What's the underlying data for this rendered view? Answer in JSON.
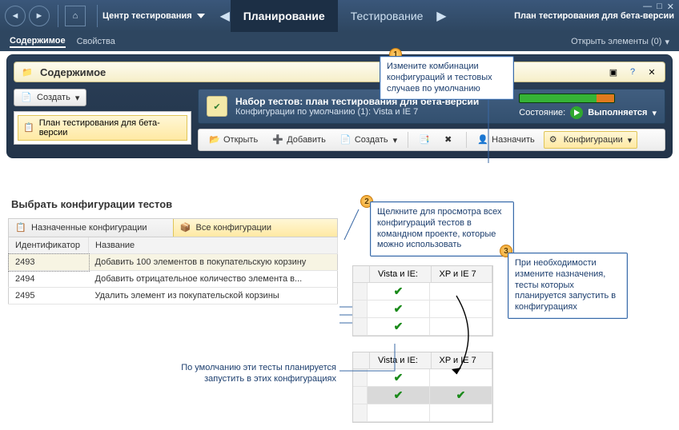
{
  "window": {
    "title": "Центр тестирования"
  },
  "nav": {
    "tabs": {
      "planning": "Планирование",
      "testing": "Тестирование"
    },
    "plan_info": "План тестирования для бета-версии"
  },
  "subnav": {
    "contents": "Содержимое",
    "properties": "Свойства",
    "open_items": "Открыть элементы (0)"
  },
  "panel": {
    "title": "Содержимое"
  },
  "sidebar": {
    "create_label": "Создать",
    "tree_item": "План тестирования для бета-версии"
  },
  "suite": {
    "title": "Набор тестов: план тестирования для бета-версии",
    "subtitle": "Конфигурации по умолчанию (1): Vista и IE 7",
    "state_label": "Состояние:",
    "state_value": "Выполняется"
  },
  "toolbar": {
    "open": "Открыть",
    "add": "Добавить",
    "create": "Создать",
    "assign": "Назначить",
    "configs": "Конфигурации"
  },
  "config_section": {
    "title": "Выбрать конфигурации тестов",
    "tab_assigned": "Назначенные конфигурации",
    "tab_all": "Все конфигурации",
    "columns": {
      "id": "Идентификатор",
      "name": "Название"
    },
    "rows": [
      {
        "id": "2493",
        "name": "Добавить 100 элементов в покупательскую корзину"
      },
      {
        "id": "2494",
        "name": "Добавить отрицательное количество элемента в..."
      },
      {
        "id": "2495",
        "name": "Удалить элемент из покупательской корзины"
      }
    ]
  },
  "matrix": {
    "col1": "Vista и IE:",
    "col2": "XP и IE 7"
  },
  "callouts": {
    "c1": "Измените комбинации конфигураций и тестовых случаев по умолчанию",
    "c2": "Щелкните для просмотра всех конфигураций тестов в командном проекте, которые можно использовать",
    "c3": "При необходимости измените назначения, тесты которых планируется запустить в конфигурациях",
    "note": "По умолчанию эти тесты планируется запустить в этих конфигурациях"
  }
}
